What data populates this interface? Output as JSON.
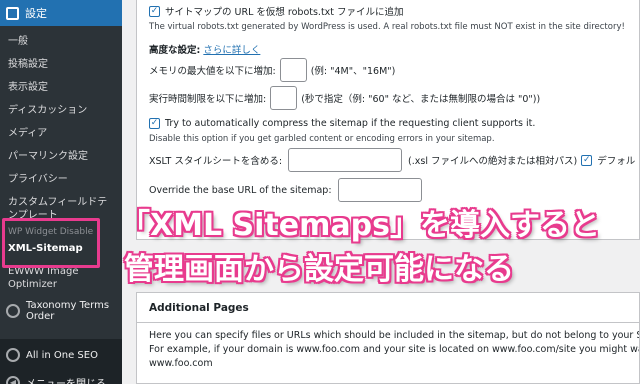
{
  "sidebar": {
    "header": "設定",
    "items": [
      "一般",
      "投稿設定",
      "表示設定",
      "ディスカッション",
      "メディア",
      "パーマリンク設定",
      "プライバシー",
      "カスタムフィールドテンプレート",
      "XML-Sitemap",
      "EWWW Image Optimizer"
    ],
    "partial_item": "WP Widget Disable",
    "taxonomy": "Taxonomy Terms Order",
    "aioseo": "All in One SEO",
    "collapse": "メニューを閉じる"
  },
  "settings": {
    "sitemap_url_label": "サイトマップの URL を仮想 robots.txt ファイルに追加",
    "robots_note": "The virtual robots.txt generated by WordPress is used. A real robots.txt file must NOT exist in the site directory!",
    "advanced_label": "高度な設定:",
    "advanced_link": "さらに詳しく",
    "memory_label": "メモリの最大値を以下に増加:",
    "memory_hint": "(例: \"4M\"、\"16M\")",
    "time_label": "実行時間制限を以下に増加:",
    "time_hint": "(秒で指定（例: \"60\" など、または無制限の場合は \"0\"))",
    "compress_label": "Try to automatically compress the sitemap if the requesting client supports it.",
    "compress_note": "Disable this option if you get garbled content or encoding errors in your sitemap.",
    "xslt_label": "XSLT スタイルシートを含める:",
    "xslt_hint": "(.xsl ファイルへの絶対または相対パス)",
    "xslt_default": "デフォル",
    "baseurl_label": "Override the base URL of the sitemap:"
  },
  "overlay": {
    "line1": "「XML Sitemaps」を導入すると",
    "line2": "管理画面から設定可能になる"
  },
  "additional": {
    "title": "Additional Pages",
    "line1": "Here you can specify files or URLs which should be included in the sitemap, but do not belong to your Site",
    "line2": "For example, if your domain is www.foo.com and your site is located on www.foo.com/site you might want",
    "line3": "www.foo.com"
  },
  "colors": {
    "accent": "#2271b1",
    "highlight": "#e83b8e",
    "sidebar_bg": "#1d2327"
  }
}
